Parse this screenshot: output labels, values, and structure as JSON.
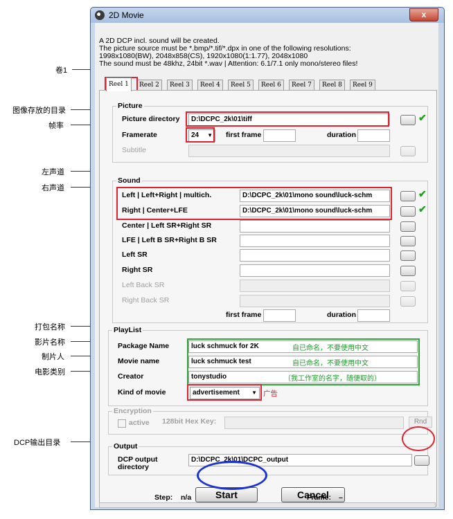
{
  "window": {
    "title": "2D Movie",
    "close_label": "x"
  },
  "intro": {
    "line1": "A 2D DCP incl. sound will be created.",
    "line2": "The picture source must be *.bmp/*.tif/*.dpx in one of the following resolutions:",
    "line3": "1998x1080(BW), 2048x858(CS), 1920x1080(1:1.77), 2048x1080",
    "line4": "The sound must be 48khz, 24bit *.wav | Attention: 6.1/7.1 only mono/stereo files!"
  },
  "tabs": [
    "Reel 1",
    "Reel 2",
    "Reel 3",
    "Reel 4",
    "Reel 5",
    "Reel 6",
    "Reel 7",
    "Reel 8",
    "Reel 9"
  ],
  "picture": {
    "group_label": "Picture",
    "dir_label": "Picture directory",
    "dir_value": "D:\\DCPC_2k\\01\\tiff",
    "framerate_label": "Framerate",
    "framerate_value": "24",
    "first_frame_label": "first frame",
    "duration_label": "duration",
    "subtitle_label": "Subtitle"
  },
  "sound": {
    "group_label": "Sound",
    "left_label": "Left     | Left+Right | multich.",
    "left_value": "D:\\DCPC_2k\\01\\mono sound\\luck-schm",
    "right_label": "Right   | Center+LFE",
    "right_value": "D:\\DCPC_2k\\01\\mono sound\\luck-schm",
    "center_label": "Center | Left SR+Right SR",
    "lfe_label": "LFE      | Left B SR+Right B SR",
    "leftsr_label": "Left SR",
    "rightsr_label": "Right SR",
    "leftback_label": "Left Back SR",
    "rightback_label": "Right Back SR",
    "first_frame_label": "first frame",
    "duration_label": "duration"
  },
  "playlist": {
    "group_label": "PlayList",
    "package_label": "Package Name",
    "package_value": "luck schmuck for 2K",
    "movie_label": "Movie name",
    "movie_value": "luck schmuck test",
    "creator_label": "Creator",
    "creator_value": "tonystudio",
    "kind_label": "Kind of movie",
    "kind_value": "advertisement",
    "note_package": "自已命名，不要使用中文",
    "note_movie": "自已命名，不要使用中文",
    "note_creator": "（我工作室的名字，随便取的）",
    "note_kind": "广告"
  },
  "encryption": {
    "group_label": "Encryption",
    "active_label": "active",
    "key_label": "128bit Hex Key:",
    "rnd_label": "Rnd"
  },
  "output": {
    "group_label": "Output",
    "dir_label_1": "DCP output",
    "dir_label_2": "directory",
    "dir_value": "D:\\DCPC_2k\\01\\DCPC_output"
  },
  "actions": {
    "start_label": "Start",
    "cancel_label": "Cancel"
  },
  "status": {
    "step_label": "Step:",
    "step_value": "n/a",
    "frame_label": "Frame:",
    "frame_value": "–"
  },
  "annotations": {
    "reel": "卷1",
    "picture_dir": "图像存放的目录",
    "framerate": "帧率",
    "left": "左声道",
    "right": "右声道",
    "package": "打包名称",
    "movie": "影片名称",
    "creator": "制片人",
    "kind": "电影类别",
    "output": "DCP输出目录"
  },
  "colors": {
    "annotation_red": "#e0232f",
    "annotation_green": "#2fa63a",
    "annotation_blue": "#1a33d6"
  }
}
